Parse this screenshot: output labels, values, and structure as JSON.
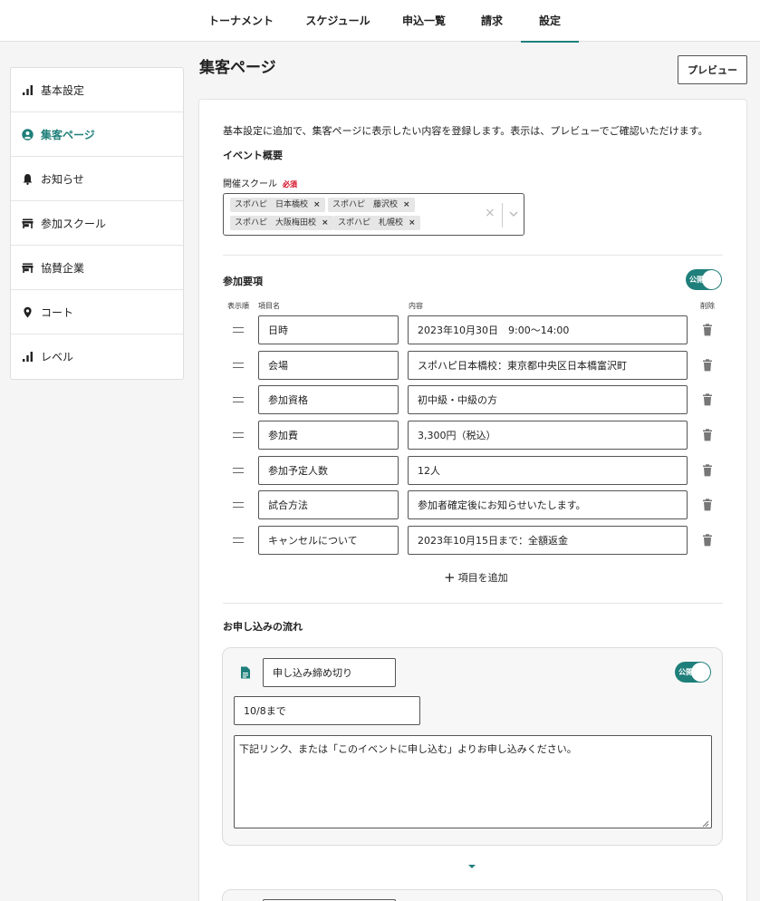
{
  "nav": {
    "tabs": [
      {
        "label": "トーナメント"
      },
      {
        "label": "スケジュール"
      },
      {
        "label": "申込一覧"
      },
      {
        "label": "請求"
      },
      {
        "label": "設定"
      }
    ]
  },
  "sidebar": {
    "items": [
      {
        "label": "基本設定",
        "icon": "bar-chart-icon"
      },
      {
        "label": "集客ページ",
        "icon": "account-circle-icon"
      },
      {
        "label": "お知らせ",
        "icon": "bell-icon"
      },
      {
        "label": "参加スクール",
        "icon": "store-icon"
      },
      {
        "label": "協賛企業",
        "icon": "store-icon"
      },
      {
        "label": "コート",
        "icon": "location-pin-icon"
      },
      {
        "label": "レベル",
        "icon": "bar-chart-icon"
      }
    ]
  },
  "page": {
    "title": "集客ページ",
    "preview_label": "プレビュー",
    "description": "基本設定に追加で、集客ページに表示したい内容を登録します。表示は、プレビューでご確認いただけます。"
  },
  "overview": {
    "title": "イベント概要",
    "school_label": "開催スクール",
    "required_label": "必須",
    "schools": [
      "スポハピ　日本橋校",
      "スポハピ　藤沢校",
      "スポハピ　大阪梅田校",
      "スポハピ　札幌校"
    ],
    "remove_glyph": "×",
    "clear_glyph": "×"
  },
  "requirements": {
    "title": "参加要項",
    "toggle_label": "公開",
    "col_order": "表示順",
    "col_name": "項目名",
    "col_content": "内容",
    "col_delete": "削除",
    "rows": [
      {
        "name": "日時",
        "content": "2023年10月30日　9:00〜14:00"
      },
      {
        "name": "会場",
        "content": "スポハピ日本橋校：東京都中央区日本橋富沢町"
      },
      {
        "name": "参加資格",
        "content": "初中級・中級の方"
      },
      {
        "name": "参加費",
        "content": "3,300円（税込）"
      },
      {
        "name": "参加予定人数",
        "content": "12人"
      },
      {
        "name": "試合方法",
        "content": "参加者確定後にお知らせいたします。"
      },
      {
        "name": "キャンセルについて",
        "content": "2023年10月15日まで：全額返金"
      }
    ],
    "add_plus": "+",
    "add_label": "項目を追加"
  },
  "flow": {
    "title": "お申し込みの流れ",
    "step_title": "申し込み締め切り",
    "toggle_label": "公開",
    "deadline": "10/8まで",
    "body": "下記リンク、または「このイベントに申し込む」よりお申し込みください。"
  },
  "colors": {
    "accent": "#1f7f7a",
    "required": "#d0021b"
  }
}
